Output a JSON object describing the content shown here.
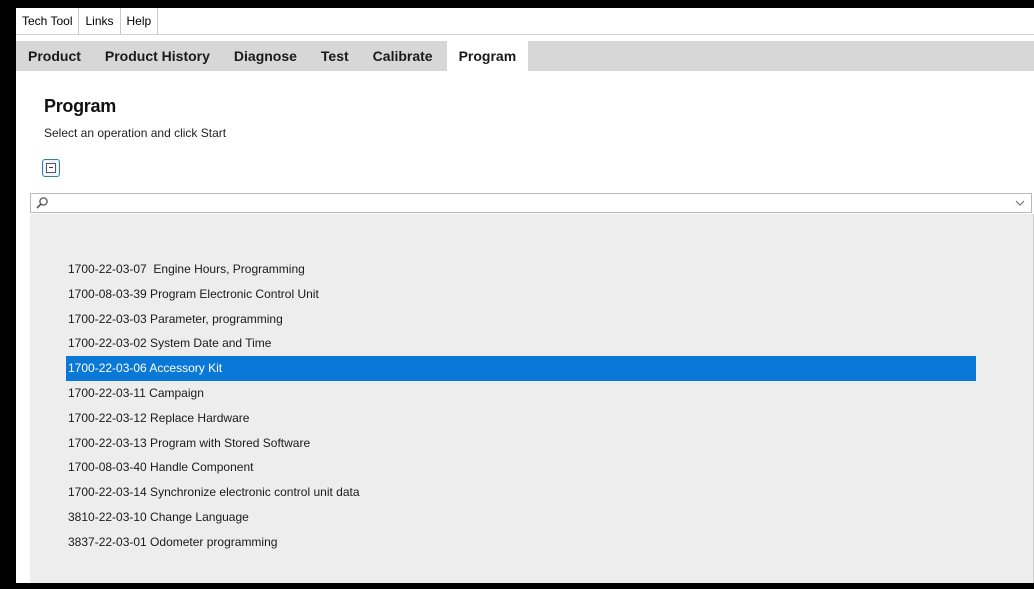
{
  "menu": {
    "items": [
      {
        "label": "Tech Tool"
      },
      {
        "label": "Links"
      },
      {
        "label": "Help"
      }
    ]
  },
  "tabs": [
    {
      "label": "Product",
      "active": false
    },
    {
      "label": "Product History",
      "active": false
    },
    {
      "label": "Diagnose",
      "active": false
    },
    {
      "label": "Test",
      "active": false
    },
    {
      "label": "Calibrate",
      "active": false
    },
    {
      "label": "Program",
      "active": true
    }
  ],
  "page": {
    "title": "Program",
    "subtitle": "Select an operation and click Start"
  },
  "search": {
    "value": "",
    "placeholder": "",
    "icon": "search-icon",
    "dropdown_icon": "chevron-down-icon"
  },
  "operations": {
    "selected_index": 4,
    "items": [
      {
        "label": "1700-22-03-07  Engine Hours, Programming"
      },
      {
        "label": "1700-08-03-39 Program Electronic Control Unit"
      },
      {
        "label": "1700-22-03-03 Parameter, programming"
      },
      {
        "label": "1700-22-03-02 System Date and Time"
      },
      {
        "label": "1700-22-03-06 Accessory Kit"
      },
      {
        "label": "1700-22-03-11 Campaign"
      },
      {
        "label": "1700-22-03-12 Replace Hardware"
      },
      {
        "label": "1700-22-03-13 Program with Stored Software"
      },
      {
        "label": "1700-08-03-40 Handle Component"
      },
      {
        "label": "1700-22-03-14 Synchronize electronic control unit data"
      },
      {
        "label": "3810-22-03-10 Change Language"
      },
      {
        "label": "3837-22-03-01 Odometer programming"
      }
    ]
  },
  "colors": {
    "selection": "#0a78d7",
    "tab_bar": "#d7d7d7",
    "list_background": "#ededed"
  }
}
